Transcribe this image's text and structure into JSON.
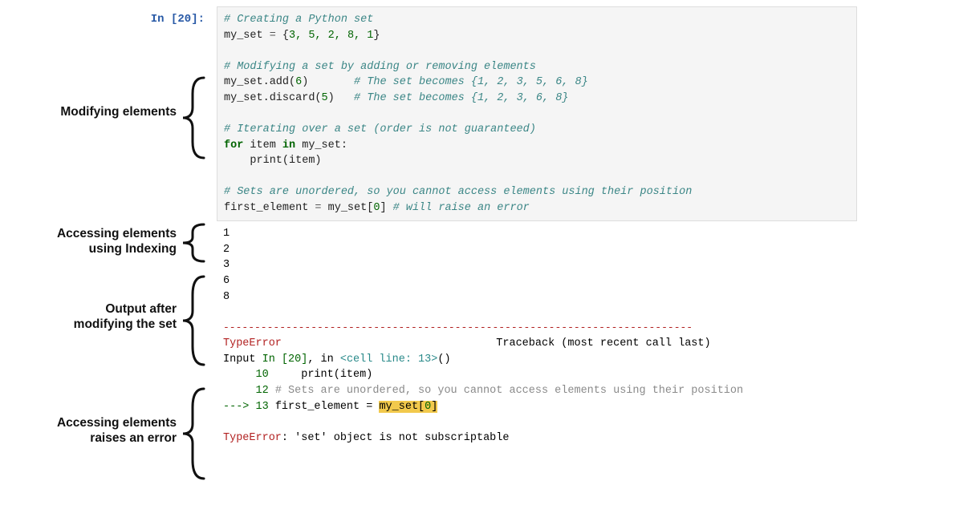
{
  "prompt": "In [20]:",
  "annotations": {
    "modifying": "Modifying elements",
    "indexing_l1": "Accessing elements",
    "indexing_l2": "using Indexing",
    "output_l1": "Output after",
    "output_l2": "modifying the set",
    "error_l1": "Accessing elements",
    "error_l2": "raises an error"
  },
  "code": {
    "l1_comment": "# Creating a Python set",
    "l2_a": "my_set ",
    "l2_op": "=",
    "l2_b": " {",
    "l2_nums": "3, 5, 2, 8, 1",
    "l2_c": "}",
    "l4_comment": "# Modifying a set by adding or removing elements",
    "l5_a": "my_set.add(",
    "l5_num": "6",
    "l5_b": ")       ",
    "l5_comment": "# The set becomes {1, 2, 3, 5, 6, 8}",
    "l6_a": "my_set.discard(",
    "l6_num": "5",
    "l6_b": ")   ",
    "l6_comment": "# The set becomes {1, 2, 3, 6, 8}",
    "l8_comment": "# Iterating over a set (order is not guaranteed)",
    "l9_for": "for",
    "l9_a": " item ",
    "l9_in": "in",
    "l9_b": " my_set:",
    "l10_a": "    print(item)",
    "l12_comment": "# Sets are unordered, so you cannot access elements using their position",
    "l13_a": "first_element ",
    "l13_op": "=",
    "l13_b": " my_set[",
    "l13_num": "0",
    "l13_c": "] ",
    "l13_comment": "# will raise an error"
  },
  "output_numbers": [
    "1",
    "2",
    "3",
    "6",
    "8"
  ],
  "traceback": {
    "dashes": "---------------------------------------------------------------------------",
    "err_name": "TypeError",
    "trace_label": "Traceback (most recent call last)",
    "line2_a": "Input ",
    "line2_b": "In [20]",
    "line2_c": ", in ",
    "line2_d": "<cell line: 13>",
    "line2_e": "()",
    "l10_num": "     10",
    "l10_txt": "     print(item)",
    "l12_num": "     12",
    "l12_txt": " # Sets are unordered, so you cannot access elements using their position",
    "arrow": "---> ",
    "l13_num": "13",
    "l13_txt_a": " first_element = ",
    "l13_hl_a": "my_set[",
    "l13_hl_num": "0",
    "l13_hl_b": "]",
    "final_a": "TypeError",
    "final_b": ": 'set' object is not subscriptable"
  }
}
